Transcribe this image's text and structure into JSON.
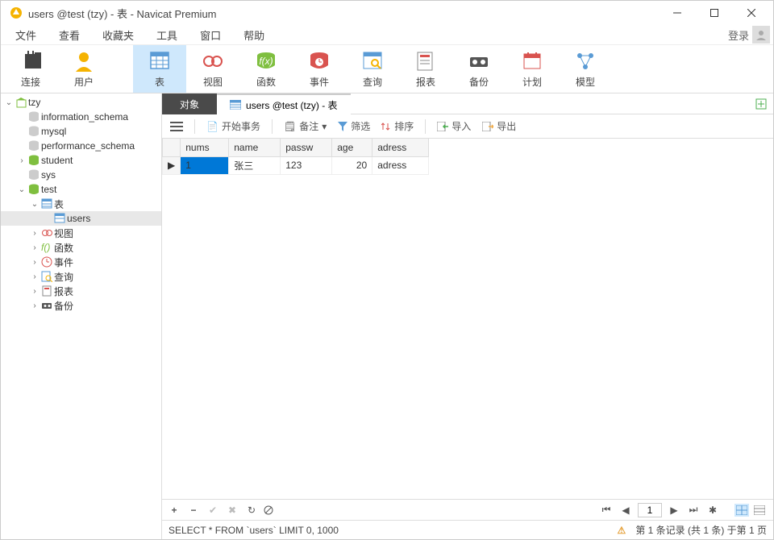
{
  "title": "users @test (tzy) - 表 - Navicat Premium",
  "menu": {
    "items": [
      "文件",
      "查看",
      "收藏夹",
      "工具",
      "窗口",
      "帮助"
    ],
    "login": "登录"
  },
  "toolbar": [
    {
      "label": "连接",
      "icon": "plug"
    },
    {
      "label": "用户",
      "icon": "user"
    },
    {
      "label": "表",
      "icon": "table",
      "active": true
    },
    {
      "label": "视图",
      "icon": "view"
    },
    {
      "label": "函数",
      "icon": "fx"
    },
    {
      "label": "事件",
      "icon": "event"
    },
    {
      "label": "查询",
      "icon": "query"
    },
    {
      "label": "报表",
      "icon": "report"
    },
    {
      "label": "备份",
      "icon": "backup"
    },
    {
      "label": "计划",
      "icon": "plan"
    },
    {
      "label": "模型",
      "icon": "model"
    }
  ],
  "tree": [
    {
      "depth": 0,
      "exp": "v",
      "icon": "conn",
      "label": "tzy"
    },
    {
      "depth": 1,
      "exp": "",
      "icon": "db-off",
      "label": "information_schema"
    },
    {
      "depth": 1,
      "exp": "",
      "icon": "db-off",
      "label": "mysql"
    },
    {
      "depth": 1,
      "exp": "",
      "icon": "db-off",
      "label": "performance_schema"
    },
    {
      "depth": 1,
      "exp": ">",
      "icon": "db",
      "label": "student"
    },
    {
      "depth": 1,
      "exp": "",
      "icon": "db-off",
      "label": "sys"
    },
    {
      "depth": 1,
      "exp": "v",
      "icon": "db",
      "label": "test"
    },
    {
      "depth": 2,
      "exp": "v",
      "icon": "tbls",
      "label": "表"
    },
    {
      "depth": 3,
      "exp": "",
      "icon": "tbl",
      "label": "users",
      "selected": true
    },
    {
      "depth": 2,
      "exp": ">",
      "icon": "view",
      "label": "视图"
    },
    {
      "depth": 2,
      "exp": ">",
      "icon": "fx",
      "label": "函数"
    },
    {
      "depth": 2,
      "exp": ">",
      "icon": "event",
      "label": "事件"
    },
    {
      "depth": 2,
      "exp": ">",
      "icon": "query",
      "label": "查询"
    },
    {
      "depth": 2,
      "exp": ">",
      "icon": "report",
      "label": "报表"
    },
    {
      "depth": 2,
      "exp": ">",
      "icon": "backup",
      "label": "备份"
    }
  ],
  "tabs": {
    "object_tab": "对象",
    "active_tab": "users @test (tzy) - 表"
  },
  "subtoolbar": {
    "begin_tx": "开始事务",
    "memo": "备注",
    "filter": "筛选",
    "sort": "排序",
    "import": "导入",
    "export": "导出"
  },
  "grid": {
    "columns": [
      "nums",
      "name",
      "passw",
      "age",
      "adress"
    ],
    "widths": [
      60,
      64,
      64,
      50,
      70
    ],
    "rows": [
      {
        "nums": "1",
        "name": "张三",
        "passw": "123",
        "age": "20",
        "adress": "adress"
      }
    ]
  },
  "nav": {
    "page": "1"
  },
  "statusbar": {
    "query": "SELECT * FROM `users` LIMIT 0, 1000",
    "info": "第 1 条记录 (共 1 条) 于第 1 页"
  }
}
